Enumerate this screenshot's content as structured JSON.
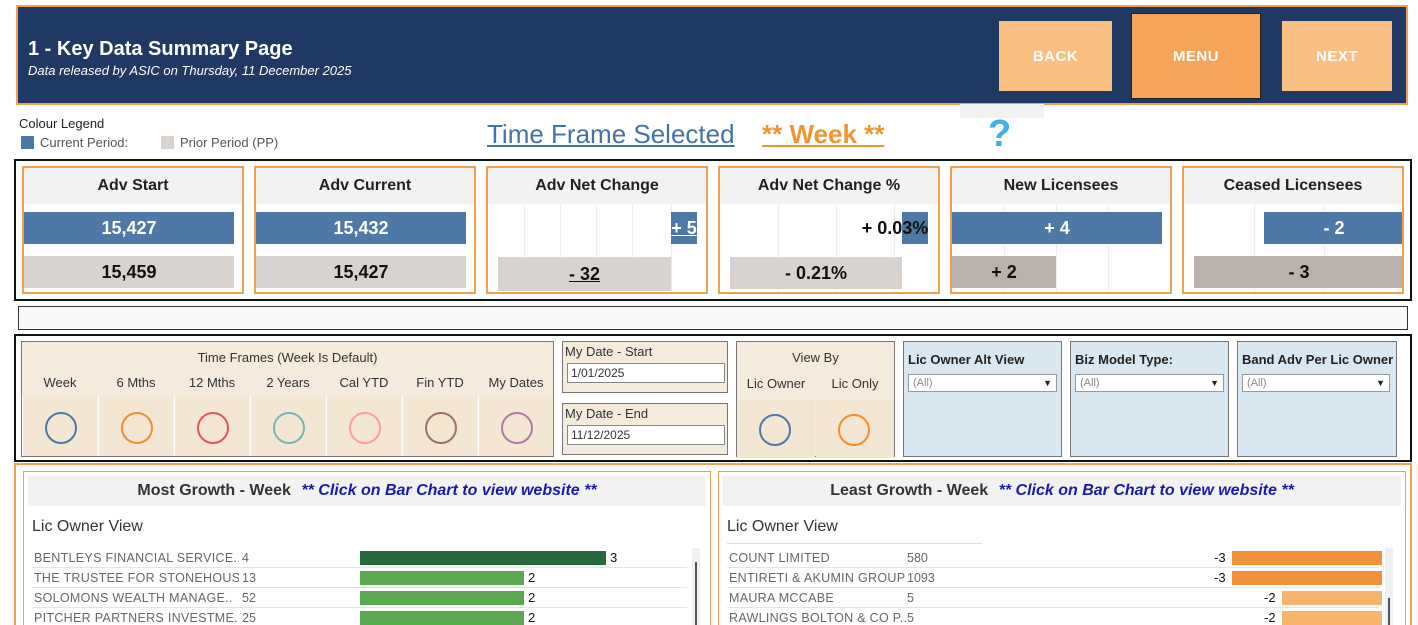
{
  "header": {
    "title": "1 - Key Data Summary Page",
    "subtitle": "Data released by ASIC on Thursday, 11 December 2025",
    "back_label": "BACK",
    "menu_label": "MENU",
    "next_label": "NEXT"
  },
  "legend": {
    "title": "Colour Legend",
    "current": "Current Period:",
    "prior": "Prior Period (PP)",
    "current_color": "#4e79a7",
    "prior_color": "#d9d3d0"
  },
  "time_frame": {
    "label": "Time Frame Selected",
    "value": "** Week **",
    "help": "?"
  },
  "kpis": [
    {
      "title": "Adv Start",
      "current": "15,427",
      "prior": "15,459"
    },
    {
      "title": "Adv Current",
      "current": "15,432",
      "prior": "15,427"
    },
    {
      "title": "Adv Net Change",
      "current": "+ 5",
      "prior": "- 32"
    },
    {
      "title": "Adv Net Change %",
      "current": "+ 0.03%",
      "prior": "- 0.21%"
    },
    {
      "title": "New Licensees",
      "current": "+ 4",
      "prior": "+ 2"
    },
    {
      "title": "Ceased Licensees",
      "current": "- 2",
      "prior": "- 3"
    }
  ],
  "filters": {
    "time_frames": {
      "header": "Time Frames (Week Is Default)",
      "options": [
        {
          "label": "Week",
          "color": "#4e79a7"
        },
        {
          "label": "6 Mths",
          "color": "#f28e2b"
        },
        {
          "label": "12 Mths",
          "color": "#e15759"
        },
        {
          "label": "2 Years",
          "color": "#76b7b2"
        },
        {
          "label": "Cal YTD",
          "color": "#ff9da7"
        },
        {
          "label": "Fin YTD",
          "color": "#9c755f"
        },
        {
          "label": "My Dates",
          "color": "#b07aa1"
        }
      ]
    },
    "date_start": {
      "label": "My Date - Start",
      "value": "1/01/2025"
    },
    "date_end": {
      "label": "My Date - End",
      "value": "11/12/2025"
    },
    "view_by": {
      "header": "View By",
      "options": [
        {
          "label": "Lic Owner",
          "color": "#4e79a7"
        },
        {
          "label": "Lic Only",
          "color": "#f28e2b"
        }
      ]
    },
    "dropdowns": [
      {
        "label": "Lic Owner Alt View",
        "value": "(All)"
      },
      {
        "label": "Biz Model Type:",
        "value": "(All)"
      },
      {
        "label": "Band Adv Per Lic Owner",
        "value": "(All)"
      }
    ]
  },
  "most_growth": {
    "title": "Most Growth - Week",
    "note": "** Click on Bar Chart to view website **",
    "subtitle": "Lic Owner View",
    "rows": [
      {
        "name": "BENTLEYS FINANCIAL SERVICE..",
        "count": "4",
        "value": 3,
        "label": "3",
        "color": "#276b3d"
      },
      {
        "name": "THE TRUSTEE FOR STONEHOUS..",
        "count": "13",
        "value": 2,
        "label": "2",
        "color": "#5aa84f"
      },
      {
        "name": "SOLOMONS WEALTH MANAGE..",
        "count": "52",
        "value": 2,
        "label": "2",
        "color": "#5aa84f"
      },
      {
        "name": "PITCHER PARTNERS INVESTME..",
        "count": "25",
        "value": 2,
        "label": "2",
        "color": "#5aa84f"
      }
    ]
  },
  "least_growth": {
    "title": "Least Growth - Week",
    "note": "** Click on Bar Chart to view website **",
    "subtitle": "Lic Owner View",
    "rows": [
      {
        "name": "COUNT LIMITED",
        "count": "580",
        "value": -3,
        "label": "-3",
        "color": "#f2913a"
      },
      {
        "name": "ENTIRETI & AKUMIN GROUP",
        "count": "1093",
        "value": -3,
        "label": "-3",
        "color": "#f2913a"
      },
      {
        "name": "MAURA  MCCABE",
        "count": "5",
        "value": -2,
        "label": "-2",
        "color": "#f7b26b"
      },
      {
        "name": "RAWLINGS BOLTON & CO P..",
        "count": "5",
        "value": -2,
        "label": "-2",
        "color": "#f7b26b"
      }
    ]
  }
}
